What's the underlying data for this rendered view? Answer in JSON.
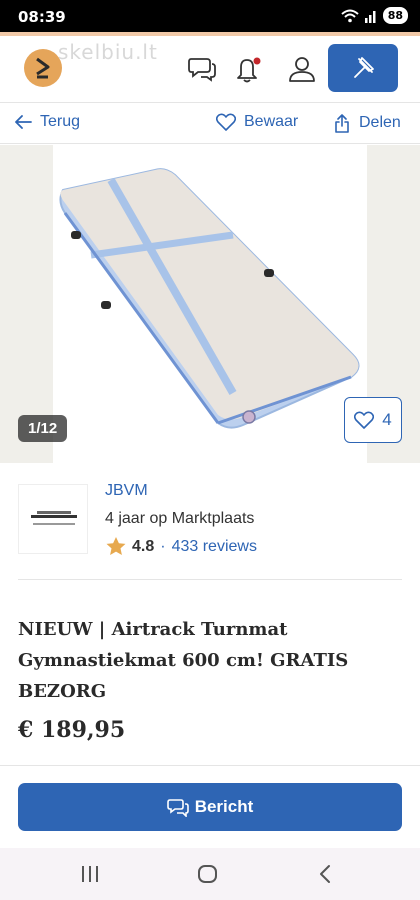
{
  "status_bar": {
    "time": "08:39",
    "battery": "88"
  },
  "header": {
    "watermark": "skelbiu.lt"
  },
  "nav": {
    "back_label": "Terug",
    "save_label": "Bewaar",
    "share_label": "Delen"
  },
  "gallery": {
    "counter": "1/12",
    "favorites_count": "4"
  },
  "seller": {
    "name": "JBVM",
    "member_since": "4 jaar op Marktplaats",
    "rating": "4.8",
    "separator": "·",
    "reviews": "433 reviews"
  },
  "listing": {
    "title": "NIEUW | Airtrack Turnmat Gymnastiekmat 600 cm! GRATIS BEZORG",
    "price": "€ 189,95"
  },
  "actions": {
    "message_label": "Bericht"
  },
  "colors": {
    "accent": "#2e65b4",
    "logo": "#e5a55a",
    "star": "#e7a94f"
  }
}
